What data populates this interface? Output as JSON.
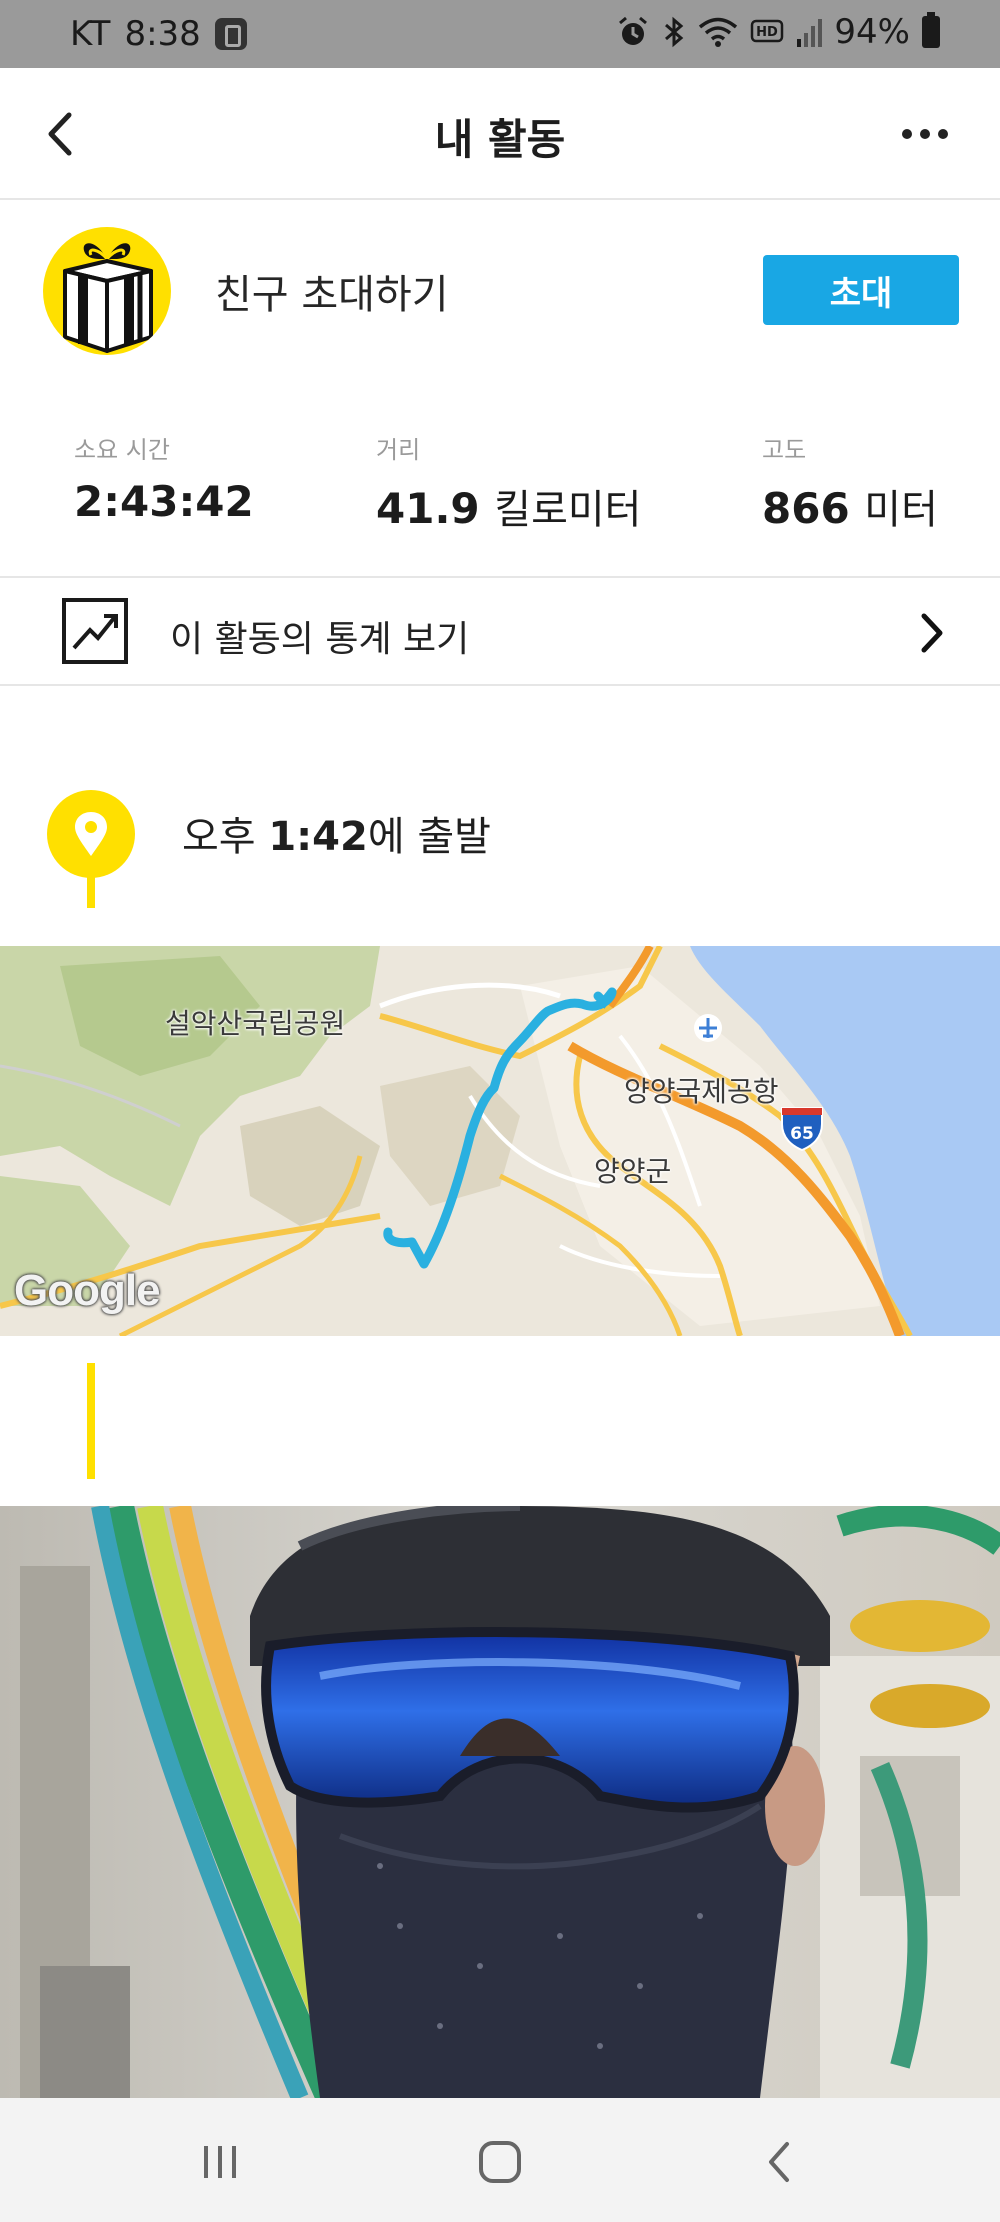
{
  "status_bar": {
    "carrier": "KT",
    "time": "8:38",
    "battery": "94%",
    "icons": [
      "app-badge-icon",
      "alarm-icon",
      "bluetooth-icon",
      "wifi-icon",
      "hd-icon",
      "signal-icon",
      "battery-icon"
    ]
  },
  "header": {
    "title": "내 활동",
    "back_icon": "chevron-left-icon",
    "more_icon": "more-horizontal-icon"
  },
  "invite": {
    "text": "친구 초대하기",
    "button_label": "초대",
    "icon": "gift-icon"
  },
  "stats": {
    "time_label": "소요 시간",
    "time_value": "2:43:42",
    "distance_label": "거리",
    "distance_value": "41.9",
    "distance_unit": "킬로미터",
    "elevation_label": "고도",
    "elevation_value": "866",
    "elevation_unit": "미터"
  },
  "stats_link": {
    "label": "이 활동의 통계 보기",
    "icon": "trend-chart-icon",
    "chevron_icon": "chevron-right-icon"
  },
  "start": {
    "prefix": "오후 ",
    "time": "1:42",
    "suffix": "에 출발",
    "icon": "location-pin-icon"
  },
  "map": {
    "labels": {
      "park": "설악산국립공원",
      "airport": "양양국제공항",
      "county": "양양군",
      "highway": "65"
    },
    "logo": "Google",
    "route_color": "#2ab0e0"
  },
  "nav": {
    "recents_icon": "recent-apps-icon",
    "home_icon": "home-icon",
    "back_icon": "back-icon"
  },
  "colors": {
    "accent_yellow": "#ffe000",
    "button_blue": "#19a7e4"
  }
}
